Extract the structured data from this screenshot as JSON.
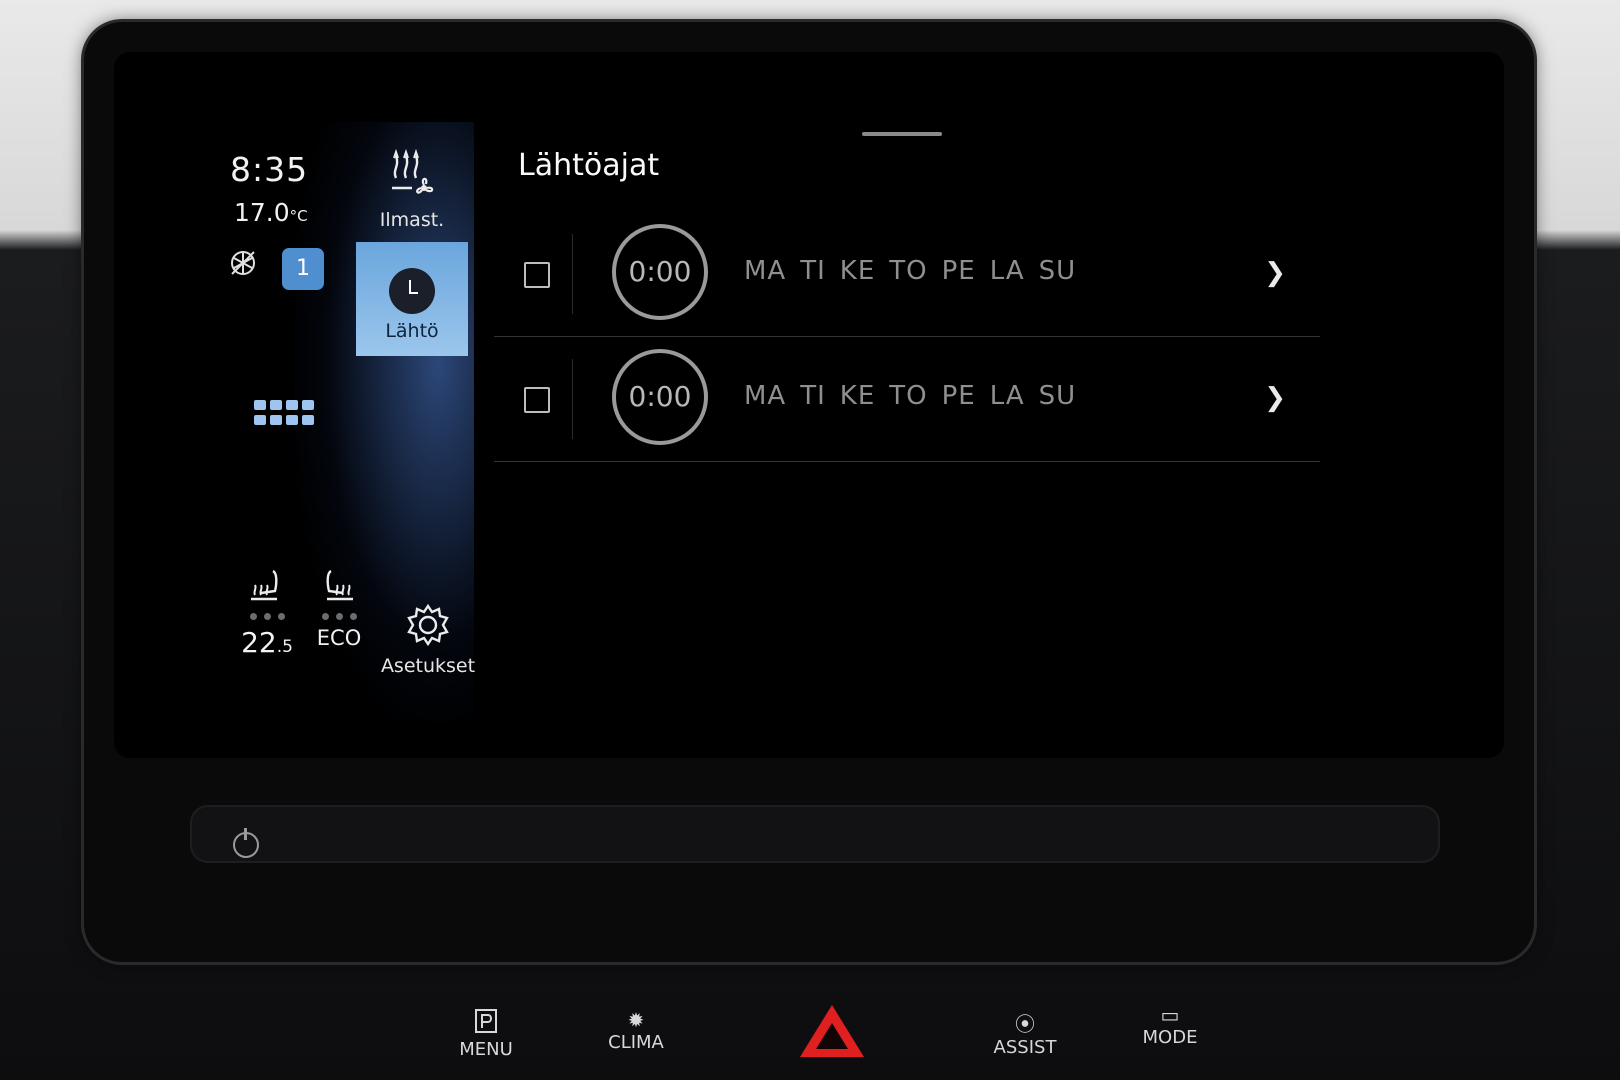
{
  "status": {
    "time": "8:35",
    "temperature": "17.0",
    "temp_unit": "°C",
    "profile": "1"
  },
  "tiles": {
    "climate_label": "Ilmast.",
    "departure_label": "Lähtö",
    "settings_label": "Asetukset"
  },
  "seats": {
    "left_temp": "22",
    "left_temp_decimal": ".5",
    "right_mode": "ECO"
  },
  "page": {
    "title": "Lähtöajat",
    "timers": [
      {
        "time": "0:00",
        "days": [
          "MA",
          "TI",
          "KE",
          "TO",
          "PE",
          "LA",
          "SU"
        ]
      },
      {
        "time": "0:00",
        "days": [
          "MA",
          "TI",
          "KE",
          "TO",
          "PE",
          "LA",
          "SU"
        ]
      }
    ]
  },
  "buttons": {
    "menu": "MENU",
    "clima": "CLIMA",
    "assist": "ASSIST",
    "mode": "MODE"
  },
  "colors": {
    "accent": "#4f8fcf",
    "hazard": "#e02020"
  }
}
